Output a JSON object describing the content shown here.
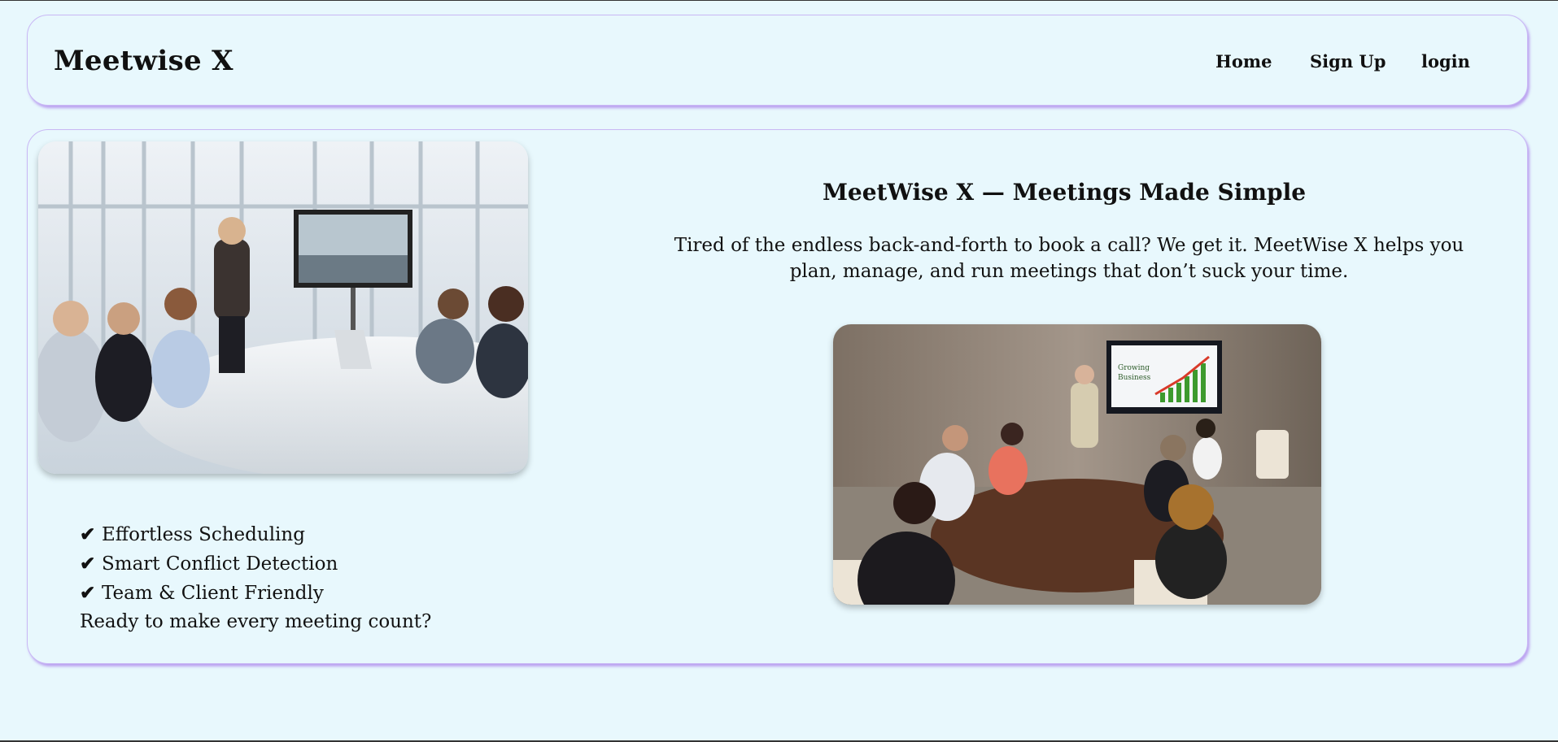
{
  "nav": {
    "brand": "Meetwise X",
    "links": [
      "Home",
      "Sign Up",
      "login"
    ]
  },
  "hero": {
    "title": "MeetWise X — Meetings Made Simple",
    "description": "Tired of the endless back-and-forth to book a call? We get it. MeetWise X helps you plan, manage, and run meetings that don’t suck your time."
  },
  "features": {
    "check_glyph": "✔",
    "items": [
      "Effortless Scheduling",
      "Smart Conflict Detection",
      "Team & Client Friendly"
    ],
    "cta_text": "Ready to make every meeting count?"
  },
  "images": {
    "left": "conference-room-video-call-photo",
    "right": "boardroom-presentation-photo",
    "right_screen_text": [
      "Growing",
      "Business"
    ]
  },
  "colors": {
    "background": "#e8f8fd",
    "card_border": "#c9b8f5",
    "card_shadow": "#9a5ae6"
  }
}
